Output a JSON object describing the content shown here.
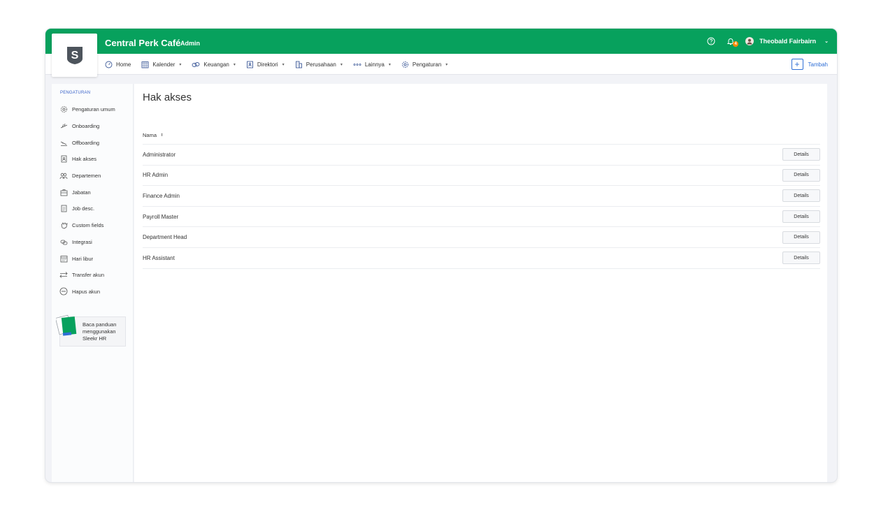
{
  "header": {
    "company": "Central Perk Café",
    "role": "Admin",
    "notification_count": "4",
    "user_name": "Theobald Fairbairn",
    "logo_letter": "S",
    "accent_color": "#07a15d"
  },
  "nav": {
    "items": [
      {
        "label": "Home",
        "icon": "gauge-icon",
        "dropdown": false
      },
      {
        "label": "Kalender",
        "icon": "calendar-icon",
        "dropdown": true
      },
      {
        "label": "Keuangan",
        "icon": "money-icon",
        "dropdown": true
      },
      {
        "label": "Direktori",
        "icon": "directory-icon",
        "dropdown": true
      },
      {
        "label": "Perusahaan",
        "icon": "building-icon",
        "dropdown": true
      },
      {
        "label": "Lainnya",
        "icon": "more-icon",
        "dropdown": true
      },
      {
        "label": "Pengaturan",
        "icon": "gear-icon",
        "dropdown": true
      }
    ],
    "add_label": "Tambah"
  },
  "sidebar": {
    "heading": "PENGATURAN",
    "items": [
      {
        "label": "Pengaturan umum",
        "icon": "gear-icon"
      },
      {
        "label": "Onboarding",
        "icon": "plane-takeoff-icon"
      },
      {
        "label": "Offboarding",
        "icon": "plane-landing-icon"
      },
      {
        "label": "Hak akses",
        "icon": "id-badge-icon"
      },
      {
        "label": "Departemen",
        "icon": "users-icon"
      },
      {
        "label": "Jabatan",
        "icon": "briefcase-icon"
      },
      {
        "label": "Job desc.",
        "icon": "document-icon"
      },
      {
        "label": "Custom fields",
        "icon": "hand-icon"
      },
      {
        "label": "Integrasi",
        "icon": "link-icon"
      },
      {
        "label": "Hari libur",
        "icon": "calendar-holiday-icon"
      },
      {
        "label": "Transfer akun",
        "icon": "transfer-icon"
      },
      {
        "label": "Hapus akun",
        "icon": "minus-circle-icon"
      }
    ],
    "guide_text": "Baca panduan menggunakan Sleekr HR"
  },
  "main": {
    "title": "Hak akses",
    "column_header": "Nama",
    "button_label": "Details",
    "rows": [
      {
        "name": "Administrator"
      },
      {
        "name": "HR Admin"
      },
      {
        "name": "Finance Admin"
      },
      {
        "name": "Payroll Master"
      },
      {
        "name": "Department Head"
      },
      {
        "name": "HR Assistant"
      }
    ]
  }
}
